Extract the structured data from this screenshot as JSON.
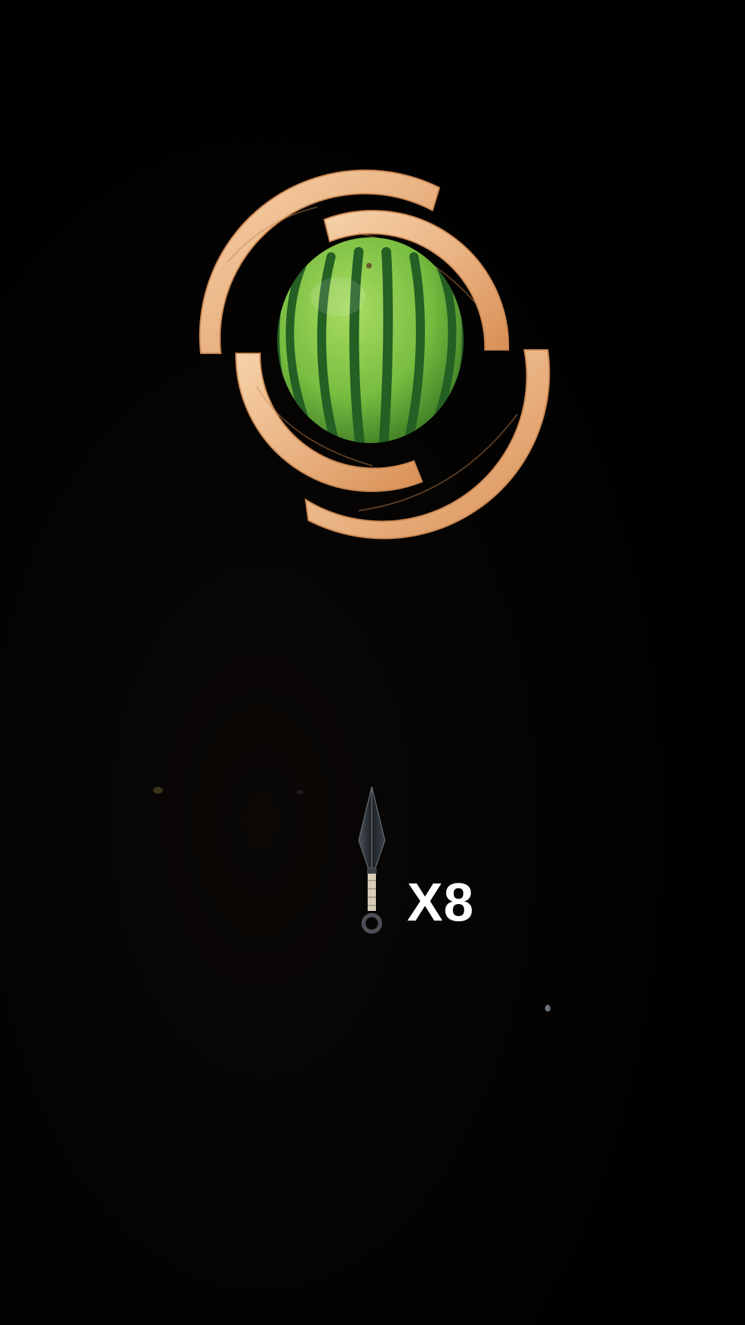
{
  "game": {
    "target": {
      "fruit": "watermelon",
      "ring_material": "wood",
      "ring_segments": 4
    },
    "knives_remaining_label": "X8",
    "knives_remaining": 8,
    "knife_icon": "kunai-icon",
    "colors": {
      "background": "#000000",
      "wood_light": "#f2c79c",
      "wood_dark": "#d9935b",
      "melon_light": "#8fd14f",
      "melon_dark": "#1f5a22",
      "counter_text": "#ffffff"
    }
  }
}
